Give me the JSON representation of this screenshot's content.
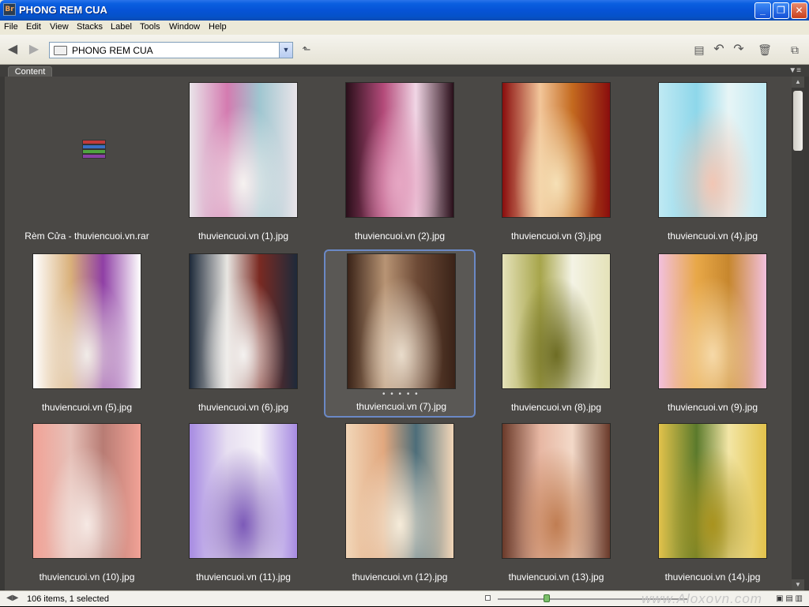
{
  "window": {
    "title": "PHONG REM CUA",
    "app_icon_text": "Br"
  },
  "menu": [
    "File",
    "Edit",
    "View",
    "Stacks",
    "Label",
    "Tools",
    "Window",
    "Help"
  ],
  "toolbar": {
    "path": "PHONG REM CUA",
    "icons": [
      "back-arrow-icon",
      "forward-arrow-icon",
      "folder-up-icon",
      "new-folder-icon",
      "rotate-left-icon",
      "rotate-right-icon",
      "trash-icon",
      "compact-mode-icon"
    ]
  },
  "panel": {
    "tab": "Content"
  },
  "items": [
    {
      "label": "Rèm Cửa - thuviencuoi.vn.rar",
      "type": "archive"
    },
    {
      "label": "thuviencuoi.vn (1).jpg",
      "colors": [
        "#e9e4e9",
        "#d47bb0",
        "#f6f2f0",
        "#9fc6d0"
      ]
    },
    {
      "label": "thuviencuoi.vn (2).jpg",
      "colors": [
        "#2a0f1a",
        "#b44b7a",
        "#e6a6c3",
        "#f1d6e5"
      ]
    },
    {
      "label": "thuviencuoi.vn (3).jpg",
      "colors": [
        "#8a0d0d",
        "#f2c69a",
        "#f6e0b6",
        "#c46a1f"
      ]
    },
    {
      "label": "thuviencuoi.vn (4).jpg",
      "colors": [
        "#bfe9f3",
        "#8ed7ea",
        "#f2c6b4",
        "#e7f5f6"
      ]
    },
    {
      "label": "thuviencuoi.vn (5).jpg",
      "colors": [
        "#ffffff",
        "#d9b07a",
        "#f1ece8",
        "#8f3fa5"
      ]
    },
    {
      "label": "thuviencuoi.vn (6).jpg",
      "colors": [
        "#1e2a3a",
        "#e8e6e2",
        "#f4f2f0",
        "#7a2a22"
      ]
    },
    {
      "label": "thuviencuoi.vn (7).jpg",
      "colors": [
        "#3a2318",
        "#b89474",
        "#e9dccb",
        "#6d4a36"
      ],
      "selected": true
    },
    {
      "label": "thuviencuoi.vn (8).jpg",
      "colors": [
        "#e5e2b9",
        "#a7a54b",
        "#6e6d24",
        "#f4f3e5"
      ]
    },
    {
      "label": "thuviencuoi.vn (9).jpg",
      "colors": [
        "#f2c0dd",
        "#e8a848",
        "#f6d9a8",
        "#c7872e"
      ]
    },
    {
      "label": "thuviencuoi.vn (10).jpg",
      "colors": [
        "#f1a296",
        "#e6c0b8",
        "#f6e9e4",
        "#b87c74"
      ]
    },
    {
      "label": "thuviencuoi.vn (11).jpg",
      "colors": [
        "#a78be2",
        "#e7dff1",
        "#7c5ab8",
        "#f6f3f8"
      ]
    },
    {
      "label": "thuviencuoi.vn (12).jpg",
      "colors": [
        "#f2d6b8",
        "#e1a87f",
        "#f6ecda",
        "#4d6e7a"
      ]
    },
    {
      "label": "thuviencuoi.vn (13).jpg",
      "colors": [
        "#6a3a2a",
        "#e7b7a3",
        "#c07d52",
        "#f3d9c8"
      ]
    },
    {
      "label": "thuviencuoi.vn (14).jpg",
      "colors": [
        "#e2c24b",
        "#5b7a2c",
        "#a9931e",
        "#f3e6a6"
      ]
    }
  ],
  "status": {
    "text": "106 items, 1 selected",
    "watermark": "www.Aloxovn.com",
    "view_buttons": "▣ ▤ ▥"
  }
}
